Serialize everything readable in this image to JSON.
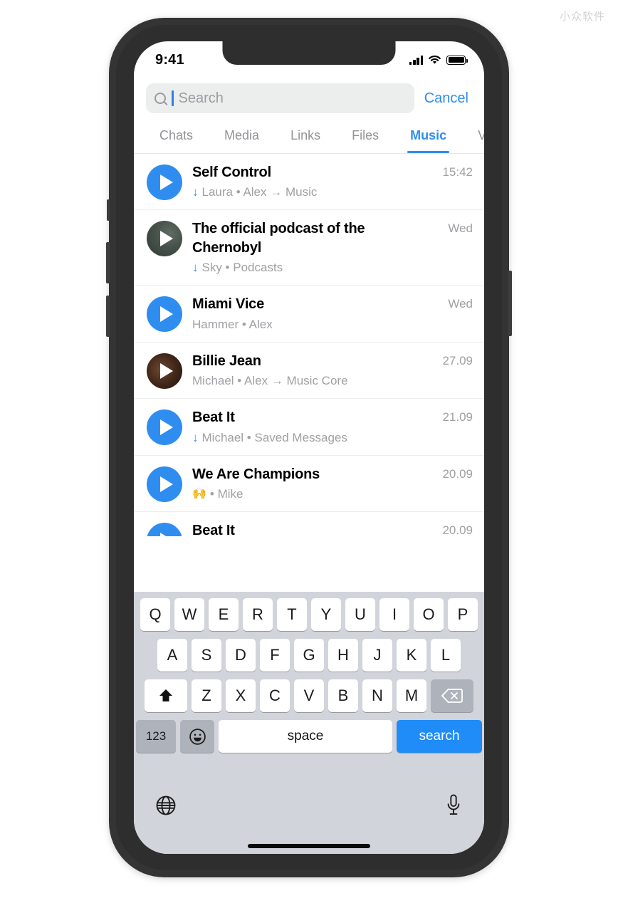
{
  "watermark": "小众软件",
  "status_bar": {
    "time": "9:41",
    "signal_icon": "signal-bars-icon",
    "wifi_icon": "wifi-icon",
    "battery_icon": "battery-full-icon"
  },
  "search": {
    "placeholder": "Search",
    "value": "",
    "icon": "search-icon",
    "cancel_label": "Cancel"
  },
  "tabs": [
    {
      "label": "Chats",
      "active": false
    },
    {
      "label": "Media",
      "active": false
    },
    {
      "label": "Links",
      "active": false
    },
    {
      "label": "Files",
      "active": false
    },
    {
      "label": "Music",
      "active": true
    },
    {
      "label": "Voi",
      "active": false
    }
  ],
  "accent_color": "#2f8df0",
  "results": [
    {
      "title": "Self Control",
      "subtitle": "Laura • Alex → Music",
      "downloaded": true,
      "time": "15:42",
      "avatar": "play-circle-blue",
      "emoji": ""
    },
    {
      "title": "The official podcast of the Chernobyl",
      "subtitle": "Sky • Podcasts",
      "downloaded": true,
      "time": "Wed",
      "avatar": "play-circle-photo-podcast",
      "emoji": ""
    },
    {
      "title": "Miami Vice",
      "subtitle": "Hammer • Alex",
      "downloaded": false,
      "time": "Wed",
      "avatar": "play-circle-blue",
      "emoji": ""
    },
    {
      "title": "Billie Jean",
      "subtitle": "Michael • Alex → Music Core",
      "downloaded": false,
      "time": "27.09",
      "avatar": "play-circle-photo-album",
      "emoji": ""
    },
    {
      "title": "Beat It",
      "subtitle": "Michael • Saved Messages",
      "downloaded": true,
      "time": "21.09",
      "avatar": "play-circle-blue",
      "emoji": ""
    },
    {
      "title": "We Are Champions",
      "subtitle": "• Mike",
      "downloaded": false,
      "time": "20.09",
      "avatar": "play-circle-blue",
      "emoji": "🙌"
    },
    {
      "title": "Beat It",
      "subtitle": "",
      "downloaded": false,
      "time": "20.09",
      "avatar": "play-circle-blue",
      "emoji": ""
    }
  ],
  "download_arrow": "↓",
  "keyboard": {
    "row1": [
      "Q",
      "W",
      "E",
      "R",
      "T",
      "Y",
      "U",
      "I",
      "O",
      "P"
    ],
    "row2": [
      "A",
      "S",
      "D",
      "F",
      "G",
      "H",
      "J",
      "K",
      "L"
    ],
    "row3": [
      "Z",
      "X",
      "C",
      "V",
      "B",
      "N",
      "M"
    ],
    "shift_icon": "shift-icon",
    "backspace_icon": "backspace-icon",
    "numeric_label": "123",
    "emoji_icon": "emoji-smiley-icon",
    "space_label": "space",
    "search_label": "search",
    "globe_icon": "globe-icon",
    "mic_icon": "microphone-icon"
  }
}
